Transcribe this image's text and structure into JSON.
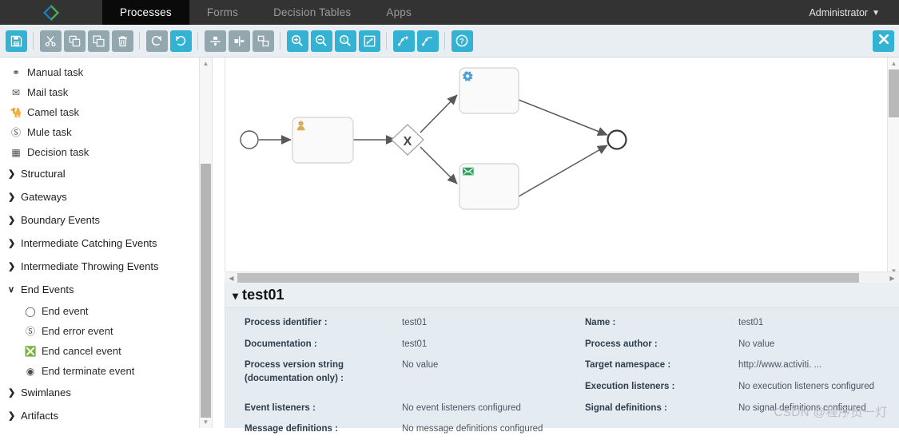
{
  "topbar": {
    "brand_icon": "diamond-logo-icon",
    "tabs": [
      {
        "label": "Processes",
        "active": true
      },
      {
        "label": "Forms",
        "active": false
      },
      {
        "label": "Decision Tables",
        "active": false
      },
      {
        "label": "Apps",
        "active": false
      }
    ],
    "user": "Administrator"
  },
  "toolbar": {
    "groups": [
      [
        {
          "name": "save-button",
          "icon": "save-icon",
          "style": "cyan"
        }
      ],
      [
        {
          "name": "cut-button",
          "icon": "scissors-icon",
          "style": "gray"
        },
        {
          "name": "copy-button",
          "icon": "copy-icon",
          "style": "gray"
        },
        {
          "name": "paste-button",
          "icon": "paste-icon",
          "style": "gray"
        },
        {
          "name": "delete-button",
          "icon": "trash-icon",
          "style": "gray"
        }
      ],
      [
        {
          "name": "redo-button",
          "icon": "redo-icon",
          "style": "gray"
        },
        {
          "name": "undo-button",
          "icon": "undo-icon",
          "style": "cyan"
        }
      ],
      [
        {
          "name": "align-vertical-button",
          "icon": "align-vertical-icon",
          "style": "gray"
        },
        {
          "name": "align-horizontal-button",
          "icon": "align-horizontal-icon",
          "style": "gray"
        },
        {
          "name": "same-size-button",
          "icon": "same-size-icon",
          "style": "gray"
        }
      ],
      [
        {
          "name": "zoom-in-button",
          "icon": "zoom-in-icon",
          "style": "cyan"
        },
        {
          "name": "zoom-out-button",
          "icon": "zoom-out-icon",
          "style": "cyan"
        },
        {
          "name": "zoom-actual-button",
          "icon": "zoom-actual-icon",
          "style": "cyan"
        },
        {
          "name": "zoom-fit-button",
          "icon": "zoom-fit-icon",
          "style": "cyan"
        }
      ],
      [
        {
          "name": "add-bendpoint-button",
          "icon": "add-bendpoint-icon",
          "style": "cyan"
        },
        {
          "name": "remove-bendpoint-button",
          "icon": "remove-bendpoint-icon",
          "style": "cyan"
        }
      ],
      [
        {
          "name": "help-button",
          "icon": "help-icon",
          "style": "cyan"
        }
      ]
    ],
    "close_label": "close-editor-button"
  },
  "palette": {
    "tasks": [
      {
        "label": "Manual task",
        "icon": "hand-icon"
      },
      {
        "label": "Mail task",
        "icon": "envelope-icon"
      },
      {
        "label": "Camel task",
        "icon": "camel-icon"
      },
      {
        "label": "Mule task",
        "icon": "mule-icon"
      },
      {
        "label": "Decision task",
        "icon": "table-icon"
      }
    ],
    "groups": [
      {
        "label": "Structural",
        "expanded": false
      },
      {
        "label": "Gateways",
        "expanded": false
      },
      {
        "label": "Boundary Events",
        "expanded": false
      },
      {
        "label": "Intermediate Catching Events",
        "expanded": false
      },
      {
        "label": "Intermediate Throwing Events",
        "expanded": false
      },
      {
        "label": "End Events",
        "expanded": true
      },
      {
        "label": "Swimlanes",
        "expanded": false
      },
      {
        "label": "Artifacts",
        "expanded": false
      }
    ],
    "end_events": [
      {
        "label": "End event",
        "icon": "circle-outline-icon"
      },
      {
        "label": "End error event",
        "icon": "circle-error-icon"
      },
      {
        "label": "End cancel event",
        "icon": "circle-cancel-icon"
      },
      {
        "label": "End terminate event",
        "icon": "circle-filled-icon"
      }
    ],
    "arrow_collapsed": "❯",
    "arrow_expanded": "∨"
  },
  "diagram": {
    "nodes": [
      {
        "name": "start-event",
        "type": "start-event"
      },
      {
        "name": "user-task",
        "type": "user-task",
        "icon": "user-icon"
      },
      {
        "name": "exclusive-gateway",
        "type": "exclusive-gateway",
        "marker": "X"
      },
      {
        "name": "service-task",
        "type": "service-task",
        "icon": "gear-icon"
      },
      {
        "name": "mail-task",
        "type": "mail-task",
        "icon": "envelope-icon"
      },
      {
        "name": "end-event",
        "type": "end-event"
      }
    ],
    "colors": {
      "user_icon": "#d6ab5a",
      "gear_icon": "#4e9fd6",
      "mail_icon": "#2ba05a",
      "stroke": "#585858",
      "node_fill": "#fafafa"
    }
  },
  "properties": {
    "title": "test01",
    "left": [
      {
        "label": "Process identifier :",
        "value": "test01"
      },
      {
        "label": "Documentation :",
        "value": "test01"
      },
      {
        "label": "Process version string (documentation only) :",
        "value": "No value"
      },
      {
        "label": "Event listeners :",
        "value": "No event listeners configured"
      },
      {
        "label": "Message definitions :",
        "value": "No message definitions configured"
      }
    ],
    "right": [
      {
        "label": "Name :",
        "value": "test01"
      },
      {
        "label": "Process author :",
        "value": "No value"
      },
      {
        "label": "Target namespace :",
        "value": "http://www.activiti. ..."
      },
      {
        "label": "Execution listeners :",
        "value": "No execution listeners configured"
      },
      {
        "label": "Signal definitions :",
        "value": "No signal definitions configured"
      }
    ]
  },
  "watermark": "CSDN @程序员一灯"
}
